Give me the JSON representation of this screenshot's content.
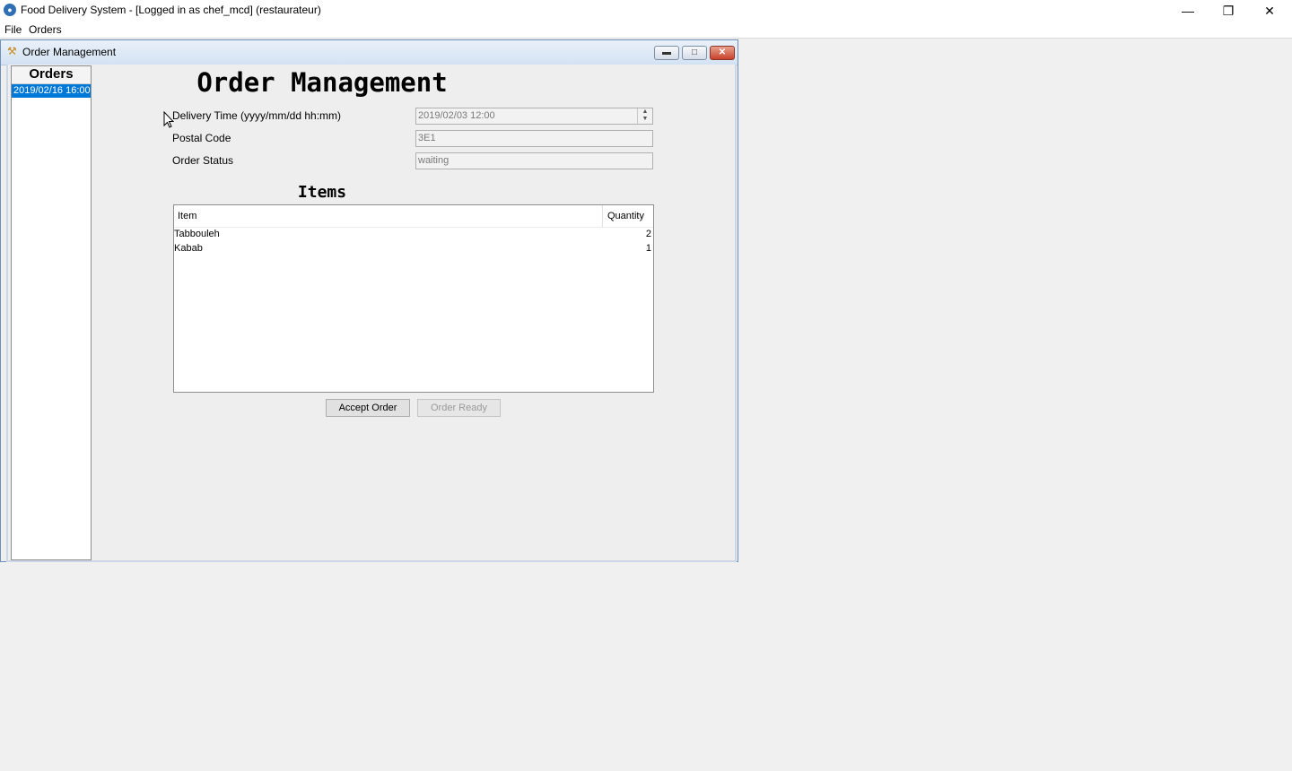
{
  "app": {
    "title": "Food Delivery System - [Logged in as chef_mcd] (restaurateur)",
    "menu": [
      "File",
      "Orders"
    ]
  },
  "window": {
    "title": "Order Management"
  },
  "orders_panel": {
    "header": "Orders",
    "items": [
      "2019/02/16 16:00"
    ],
    "selected_index": 0
  },
  "main": {
    "title": "Order Management",
    "fields": {
      "delivery_time_label": "Delivery Time (yyyy/mm/dd hh:mm)",
      "delivery_time_value": "2019/02/03 12:00",
      "postal_code_label": "Postal Code",
      "postal_code_value": "3E1",
      "order_status_label": "Order Status",
      "order_status_value": "waiting"
    },
    "items_title": "Items",
    "table": {
      "columns": [
        "Item",
        "Quantity"
      ],
      "rows": [
        {
          "item": "Tabbouleh",
          "quantity": "2"
        },
        {
          "item": "Kabab",
          "quantity": "1"
        }
      ]
    },
    "buttons": {
      "accept": "Accept Order",
      "ready": "Order Ready"
    }
  },
  "colors": {
    "selection": "#0078d7",
    "frame_border": "#6d8fb8",
    "close_button": "#c8422a"
  }
}
